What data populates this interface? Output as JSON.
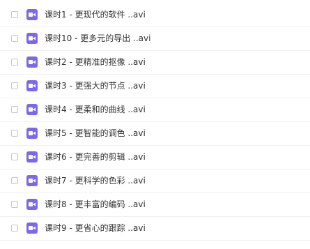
{
  "files": [
    {
      "name": "课时1 - 更现代的软件 ..avi",
      "icon": "video-file-icon"
    },
    {
      "name": "课时10 - 更多元的导出 ..avi",
      "icon": "video-file-icon"
    },
    {
      "name": "课时2 - 更精准的抠像 ..avi",
      "icon": "video-file-icon"
    },
    {
      "name": "课时3 - 更强大的节点 ..avi",
      "icon": "video-file-icon"
    },
    {
      "name": "课时4 - 更柔和的曲线 ..avi",
      "icon": "video-file-icon"
    },
    {
      "name": "课时5 - 更智能的调色 ..avi",
      "icon": "video-file-icon"
    },
    {
      "name": "课时6 - 更完善的剪辑 ..avi",
      "icon": "video-file-icon"
    },
    {
      "name": "课时7 - 更科学的色彩 ..avi",
      "icon": "video-file-icon"
    },
    {
      "name": "课时8 - 更丰富的编码 ..avi",
      "icon": "video-file-icon"
    },
    {
      "name": "课时9 - 更省心的跟踪 ..avi",
      "icon": "video-file-icon"
    }
  ],
  "colors": {
    "icon_background": "#7b68ee",
    "row_divider": "#eef0f4",
    "text": "#333333"
  }
}
